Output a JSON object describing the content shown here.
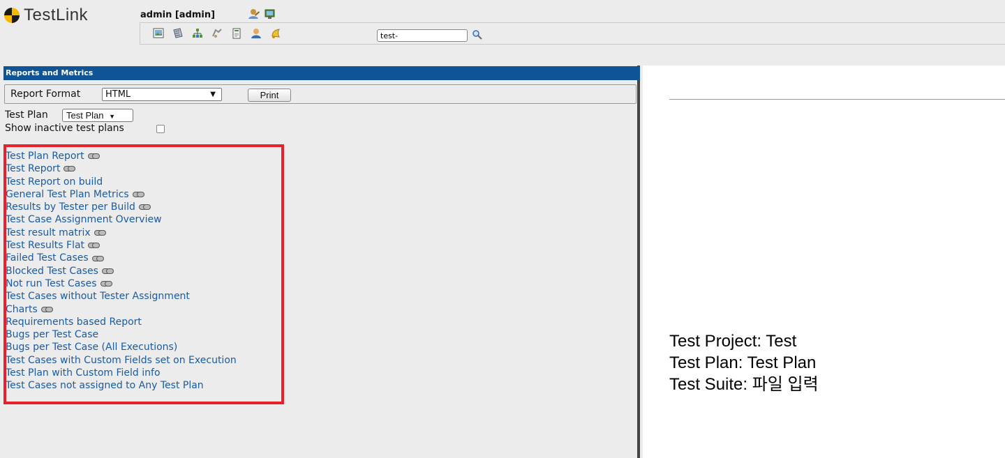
{
  "app": {
    "name": "TestLink"
  },
  "header": {
    "user": "admin [admin]",
    "search": {
      "value": "test-"
    },
    "icons": [
      "user-settings-icon",
      "logout-icon",
      "desktop-icon",
      "test-spec-icon",
      "requirements-icon",
      "execution-icon",
      "reports-icon",
      "users-icon",
      "events-icon",
      "search-icon"
    ]
  },
  "left_panel": {
    "title": "Reports and Metrics",
    "report_format": {
      "label": "Report Format",
      "selected": "HTML"
    },
    "print_label": "Print",
    "test_plan": {
      "label": "Test Plan",
      "selected": "Test Plan"
    },
    "show_inactive_label": "Show inactive test plans",
    "reports": [
      {
        "label": "Test Plan Report",
        "has_link_icon": true
      },
      {
        "label": "Test Report",
        "has_link_icon": true
      },
      {
        "label": "Test Report on build",
        "has_link_icon": false
      },
      {
        "label": "General Test Plan Metrics",
        "has_link_icon": true
      },
      {
        "label": "Results by Tester per Build",
        "has_link_icon": true
      },
      {
        "label": "Test Case Assignment Overview",
        "has_link_icon": false
      },
      {
        "label": "Test result matrix",
        "has_link_icon": true
      },
      {
        "label": "Test Results Flat",
        "has_link_icon": true
      },
      {
        "label": "Failed Test Cases",
        "has_link_icon": true
      },
      {
        "label": "Blocked Test Cases",
        "has_link_icon": true
      },
      {
        "label": "Not run Test Cases",
        "has_link_icon": true
      },
      {
        "label": "Test Cases without Tester Assignment",
        "has_link_icon": false
      },
      {
        "label": "Charts",
        "has_link_icon": true
      },
      {
        "label": "Requirements based Report",
        "has_link_icon": false
      },
      {
        "label": "Bugs per Test Case",
        "has_link_icon": false
      },
      {
        "label": "Bugs per Test Case (All Executions)",
        "has_link_icon": false
      },
      {
        "label": "Test Cases with Custom Fields set on Execution",
        "has_link_icon": false
      },
      {
        "label": "Test Plan with Custom Field info",
        "has_link_icon": false
      },
      {
        "label": "Test Cases not assigned to Any Test Plan",
        "has_link_icon": false
      }
    ]
  },
  "right_panel": {
    "project": "Test Project: Test",
    "plan": "Test Plan: Test Plan",
    "suite": "Test Suite: 파일 입력"
  },
  "colors": {
    "panel_header": "#0e5496",
    "link": "#1a5ba4",
    "highlight_box": "#e8202a"
  }
}
